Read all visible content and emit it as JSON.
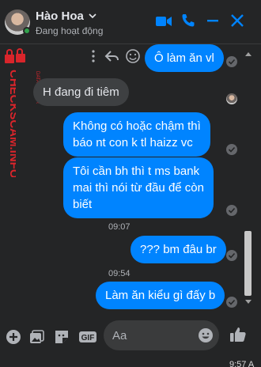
{
  "header": {
    "contact_name": "Hào Hoa",
    "status": "Đang hoạt động"
  },
  "watermark": {
    "vertical_text": "CHECKSCAM.INFO",
    "small_text": "DATA CENTER",
    "color": "#d9252b"
  },
  "messages": [
    {
      "id": 1,
      "side": "out",
      "text": "Ô làm ăn vl"
    },
    {
      "id": 2,
      "side": "in",
      "text": "H đang đi tiêm"
    },
    {
      "id": 3,
      "side": "out",
      "lines": [
        "Không có hoặc chậm thì",
        "báo nt con k tl haizz vc"
      ]
    },
    {
      "id": 4,
      "side": "out",
      "lines": [
        "Tôi cần bh thì t ms bank",
        "mai thì nói từ đầu để còn",
        "biết"
      ]
    },
    {
      "id": 5,
      "side": "out",
      "text": "??? bm đâu br"
    },
    {
      "id": 6,
      "side": "out",
      "text": "Làm ăn kiểu gì đấy b"
    }
  ],
  "timestamps": [
    "09:07",
    "09:54"
  ],
  "composer": {
    "placeholder": "Aa"
  },
  "taskbar": {
    "clock": "9:57 A"
  },
  "colors": {
    "background": "#242526",
    "outgoing_bubble": "#0084ff",
    "incoming_bubble": "#3e4042",
    "accent": "#0084ff",
    "online": "#31a24c"
  },
  "icons": {
    "header": [
      "video-camera-icon",
      "phone-icon",
      "minimize-icon",
      "close-icon"
    ],
    "composer": [
      "plus-circle-icon",
      "photo-icon",
      "sticker-icon",
      "gif-icon",
      "emoji-icon",
      "thumbs-up-icon"
    ],
    "message_actions": [
      "more-icon",
      "reply-icon",
      "emoji-reaction-icon"
    ]
  }
}
